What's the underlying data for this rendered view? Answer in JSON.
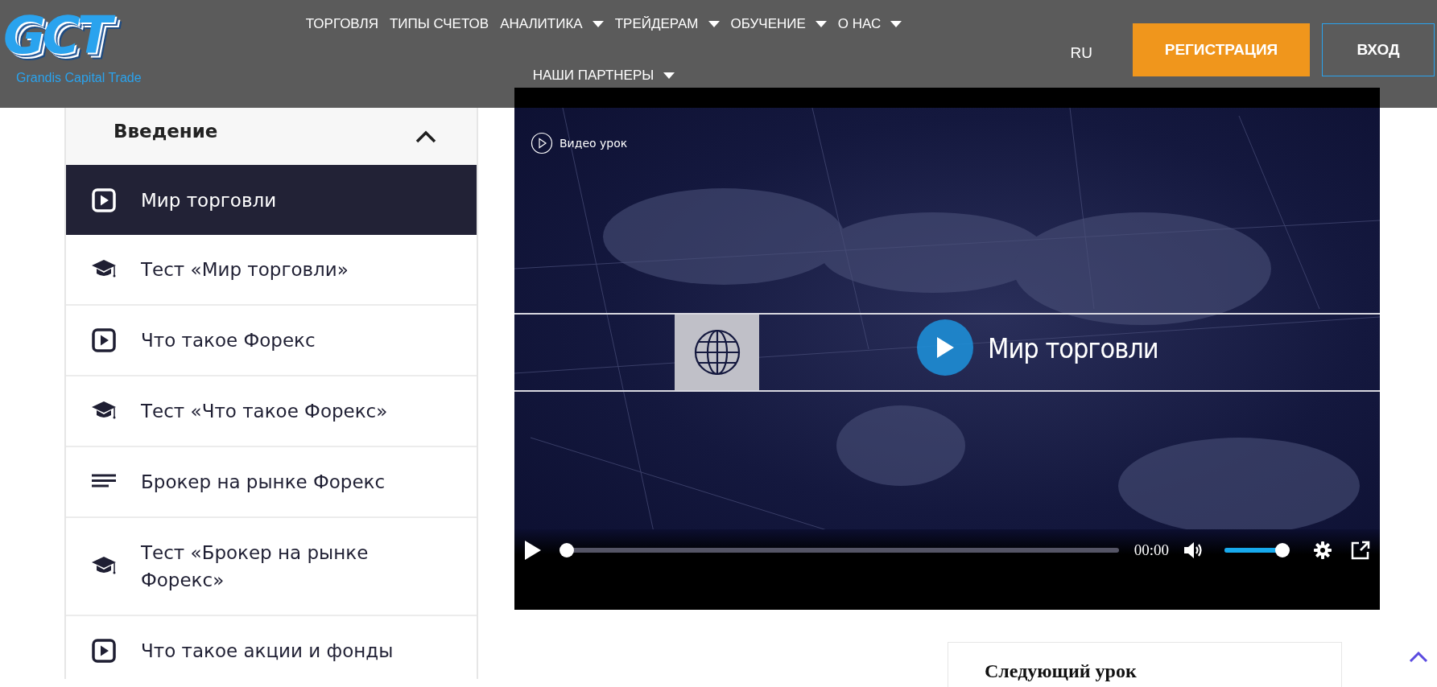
{
  "header": {
    "logo": {
      "text": "GCT",
      "subtitle": "Grandis Capital Trade"
    },
    "nav": [
      {
        "label": "ТОРГОВЛЯ",
        "dropdown": false
      },
      {
        "label": "ТИПЫ СЧЕТОВ",
        "dropdown": false
      },
      {
        "label": "АНАЛИТИКА",
        "dropdown": true
      },
      {
        "label": "ТРЕЙДЕРАМ",
        "dropdown": true
      },
      {
        "label": "ОБУЧЕНИЕ",
        "dropdown": true
      },
      {
        "label": "О НАС",
        "dropdown": true
      },
      {
        "label": "НАШИ ПАРТНЕРЫ",
        "dropdown": true
      }
    ],
    "language": "RU",
    "buttons": [
      {
        "kind": "primary",
        "label": "РЕГИСТРАЦИЯ"
      },
      {
        "kind": "outline",
        "label": "ВХОД"
      }
    ]
  },
  "sidebar": {
    "section": {
      "title": "Введение",
      "expanded": true
    },
    "items": [
      {
        "kind": "video",
        "title": "Мир торговли",
        "selected": true
      },
      {
        "kind": "test",
        "title": "Тест «Мир торговли»",
        "selected": false
      },
      {
        "kind": "video",
        "title": "Что такое Форекс",
        "selected": false
      },
      {
        "kind": "test",
        "title": "Тест «Что такое Форекс»",
        "selected": false
      },
      {
        "kind": "text",
        "title": "Брокер на рынке Форекс",
        "selected": false
      },
      {
        "kind": "test",
        "title": "Тест «Брокер на рынке Форекс»",
        "selected": false
      },
      {
        "kind": "video",
        "title": "Что такое акции и фонды",
        "selected": false
      }
    ]
  },
  "video": {
    "badge": "Видео урок",
    "title": "Мир торговли",
    "time": "00:00",
    "progress": {
      "level": 0
    },
    "volume": {
      "level": 1
    }
  },
  "next_lesson": {
    "heading": "Следующий урок"
  }
}
